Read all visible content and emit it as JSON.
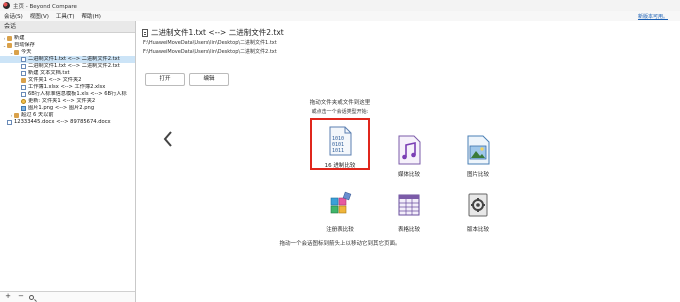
{
  "window": {
    "title": "主页 - Beyond Compare"
  },
  "menu": {
    "items": [
      "会话(S)",
      "视图(V)",
      "工具(T)",
      "帮助(H)"
    ],
    "new_version": "新版本可用。"
  },
  "sidebar": {
    "header": "会话",
    "tree": [
      {
        "label": "新建",
        "icon": "folder",
        "level": 0,
        "caret": "›"
      },
      {
        "label": "自动保存",
        "icon": "folder",
        "level": 0,
        "caret": "⌄"
      },
      {
        "label": "今天",
        "icon": "folder",
        "level": 1,
        "caret": "⌄"
      },
      {
        "label": "二进制文件1.txt <--> 二进制文件2.txt",
        "icon": "doc",
        "level": 2,
        "caret": "",
        "selected": true
      },
      {
        "label": "二进制文件1.txt <--> 二进制文件2.txt",
        "icon": "doc",
        "level": 2,
        "caret": ""
      },
      {
        "label": "新建 文本文档.txt",
        "icon": "doc",
        "level": 2,
        "caret": ""
      },
      {
        "label": "文件夹1 <--> 文件夹2",
        "icon": "folder",
        "level": 2,
        "caret": ""
      },
      {
        "label": "工作簿1.xlsx <--> 工作簿2.xlsx",
        "icon": "doc",
        "level": 2,
        "caret": ""
      },
      {
        "label": "6B行人标准信息模板1.xls <--> 6B行人标",
        "icon": "doc",
        "level": 2,
        "caret": ""
      },
      {
        "label": "更新:  文件夹1 <--> 文件夹2",
        "icon": "sync",
        "level": 2,
        "caret": ""
      },
      {
        "label": "图片1.png <--> 图片2.png",
        "icon": "img",
        "level": 2,
        "caret": ""
      },
      {
        "label": "超过 6 天以前",
        "icon": "folder",
        "level": 1,
        "caret": "›"
      },
      {
        "label": "12333445.docx <--> 89785674.docx",
        "icon": "doc",
        "level": 0,
        "caret": ""
      }
    ],
    "footer": {
      "add": "+",
      "remove": "−"
    }
  },
  "main": {
    "recent_title": "二进制文件1.txt <--> 二进制文件2.txt",
    "path_left": "F:\\HuaweiMoveData\\Users\\lin\\Desktop\\二进制文件1.txt",
    "path_right": "F:\\HuaweiMoveData\\Users\\lin\\Desktop\\二进制文件2.txt",
    "open_label": "打开",
    "edit_label": "编辑",
    "drop_hint": "拖动文件夹或文件到这里",
    "choose_hint": "或点击一个会话类型开始:",
    "bottom_hint": "拖动一个会话图标到箭头上以移动它到其它页面。",
    "tiles": [
      {
        "label": "16 进制比较",
        "icon": "hex-compare-icon",
        "highlighted": true
      },
      {
        "label": "媒体比较",
        "icon": "media-compare-icon"
      },
      {
        "label": "图片比较",
        "icon": "picture-compare-icon"
      },
      {
        "label": "注册表比较",
        "icon": "registry-compare-icon"
      },
      {
        "label": "表格比较",
        "icon": "table-compare-icon"
      },
      {
        "label": "版本比较",
        "icon": "version-compare-icon"
      }
    ],
    "highlight_color": "#e0261c"
  }
}
